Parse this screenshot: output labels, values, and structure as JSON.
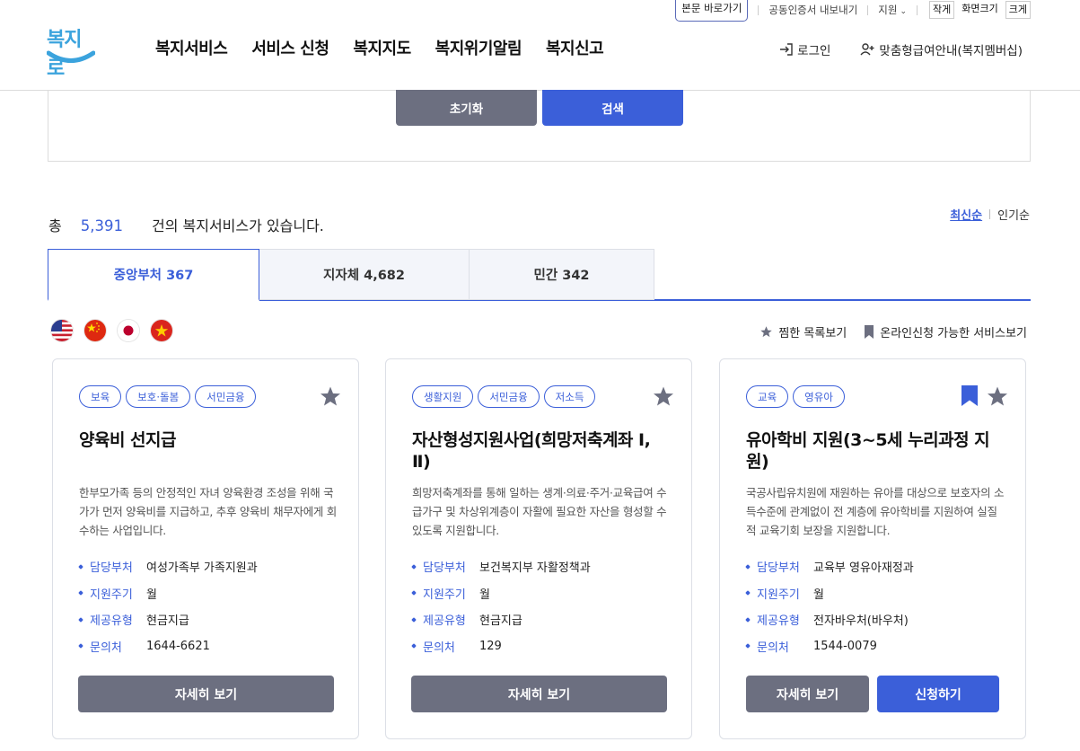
{
  "utility": {
    "skip_link": "본문 바로가기",
    "cert_export": "공동인증서 내보내기",
    "support": "지원",
    "font_small": "작게",
    "font_size": "화면크기",
    "font_large": "크게"
  },
  "header": {
    "logo_text": "복지로",
    "nav": [
      "복지서비스",
      "서비스 신청",
      "복지지도",
      "복지위기알림",
      "복지신고"
    ],
    "login": "로그인",
    "membership": "맞춤형급여안내(복지멤버십)"
  },
  "search_panel": {
    "reset": "초기화",
    "search": "검색"
  },
  "result": {
    "prefix": "총",
    "count": "5,391",
    "suffix": "건의 복지서비스가 있습니다.",
    "sort_latest": "최신순",
    "sort_popular": "인기순"
  },
  "tabs": [
    {
      "label": "중앙부처 367",
      "active": true
    },
    {
      "label": "지자체 4,682",
      "active": false
    },
    {
      "label": "민간 342",
      "active": false
    }
  ],
  "languages": [
    "us-flag-icon",
    "china-flag-icon",
    "japan-flag-icon",
    "vietnam-flag-icon"
  ],
  "toggles": {
    "favorites": "찜한 목록보기",
    "online": "온라인신청 가능한 서비스보기"
  },
  "info_labels": {
    "dept": "담당부처",
    "cycle": "지원주기",
    "type": "제공유형",
    "contact": "문의처"
  },
  "cards": [
    {
      "tags": [
        "보육",
        "보호·돌봄",
        "서민금융"
      ],
      "title": "양육비 선지급",
      "desc": "한부모가족 등의 안정적인 자녀 양육환경 조성을 위해 국가가 먼저 양육비를 지급하고, 추후 양육비 채무자에게 회수하는 사업입니다.",
      "dept": "여성가족부 가족지원과",
      "cycle": "월",
      "type": "현금지급",
      "contact": "1644-6621",
      "detail_btn": "자세히 보기"
    },
    {
      "tags": [
        "생활지원",
        "서민금융",
        "저소득"
      ],
      "title": "자산형성지원사업(희망저축계좌 Ⅰ, Ⅱ)",
      "desc": "희망저축계좌를 통해 일하는 생계·의료·주거·교육급여 수급가구 및 차상위계층이 자활에 필요한 자산을 형성할 수 있도록 지원합니다.",
      "dept": "보건복지부 자활정책과",
      "cycle": "월",
      "type": "현금지급",
      "contact": "129",
      "detail_btn": "자세히 보기"
    },
    {
      "tags": [
        "교육",
        "영유아"
      ],
      "title": "유아학비 지원(3~5세 누리과정 지원)",
      "desc": "국공사립유치원에 재원하는 유아를 대상으로 보호자의 소득수준에 관계없이 전 계층에 유아학비를 지원하여 실질적 교육기회 보장을 지원합니다.",
      "dept": "교육부 영유아재정과",
      "cycle": "월",
      "type": "전자바우처(바우처)",
      "contact": "1544-0079",
      "detail_btn": "자세히 보기",
      "apply_btn": "신청하기"
    }
  ],
  "colors": {
    "accent": "#3b5fd9",
    "button_gray": "#6c6f80",
    "star_gray": "#6c6f80"
  }
}
